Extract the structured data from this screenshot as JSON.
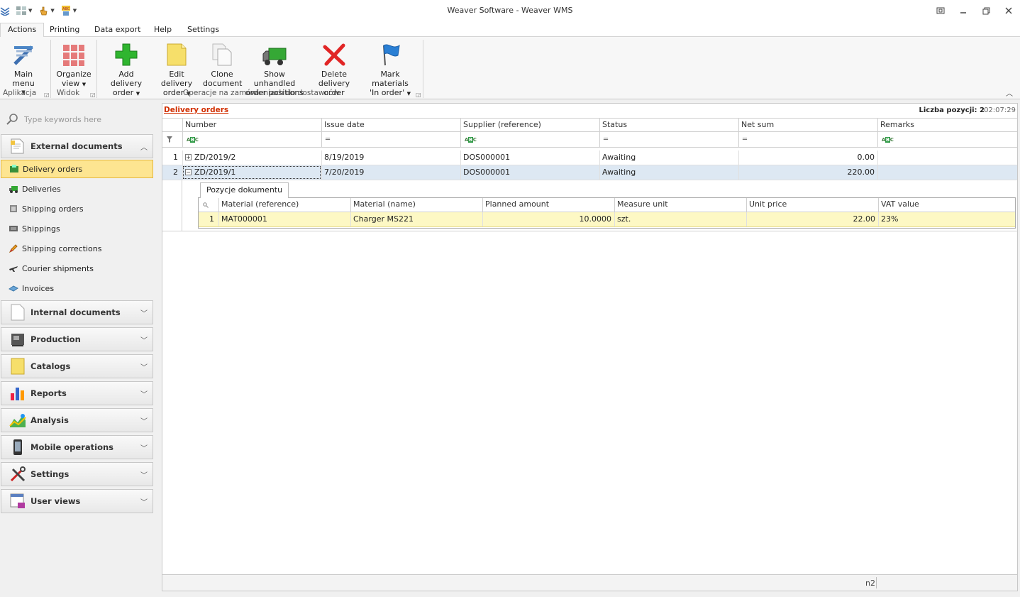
{
  "window": {
    "title": "Weaver Software - Weaver WMS"
  },
  "ribbon_tabs": [
    "Actions",
    "Printing",
    "Data export",
    "Help",
    "Settings"
  ],
  "ribbon": {
    "buttons": {
      "main_menu": {
        "line1": "Main menu",
        "line2": ""
      },
      "organize_view": {
        "line1": "Organize",
        "line2": "view"
      },
      "add_delivery": {
        "line1": "Add delivery",
        "line2": "order"
      },
      "edit_delivery": {
        "line1": "Edit delivery",
        "line2": "order"
      },
      "clone_document": {
        "line1": "Clone",
        "line2": "document"
      },
      "show_unhandled": {
        "line1": "Show unhandled",
        "line2": "order positions"
      },
      "delete_delivery": {
        "line1": "Delete",
        "line2": "delivery order"
      },
      "mark_materials": {
        "line1": "Mark materials",
        "line2": "'In order'"
      }
    },
    "groups": {
      "aplikacja": "Aplikacja",
      "widok": "Widok",
      "operacje": "Operacje na zamówieniach do dostawców"
    }
  },
  "sidebar": {
    "search_placeholder": "Type keywords here",
    "external_documents": "External documents",
    "items": [
      "Delivery orders",
      "Deliveries",
      "Shipping orders",
      "Shippings",
      "Shipping corrections",
      "Courier shipments",
      "Invoices"
    ],
    "groups": [
      "Internal documents",
      "Production",
      "Catalogs",
      "Reports",
      "Analysis",
      "Mobile operations",
      "Settings",
      "User views"
    ]
  },
  "main": {
    "title": "Delivery orders",
    "count_label": "Liczba pozycji: 2",
    "clock": "02:07:29",
    "columns": [
      "Number",
      "Issue date",
      "Supplier (reference)",
      "Status",
      "Net sum",
      "Remarks"
    ],
    "rows": [
      {
        "n": "1",
        "expander": "+",
        "number": "ZD/2019/2",
        "issue_date": "8/19/2019",
        "supplier": "DOS000001",
        "status": "Awaiting",
        "net_sum": "0.00",
        "remarks": ""
      },
      {
        "n": "2",
        "expander": "−",
        "number": "ZD/2019/1",
        "issue_date": "7/20/2019",
        "supplier": "DOS000001",
        "status": "Awaiting",
        "net_sum": "220.00",
        "remarks": ""
      }
    ],
    "detail": {
      "tab": "Pozycje dokumentu",
      "columns": [
        "Material (reference)",
        "Material (name)",
        "Planned amount",
        "Measure unit",
        "Unit price",
        "VAT value"
      ],
      "rows": [
        {
          "n": "1",
          "material_ref": "MAT000001",
          "material_name": "Charger MS221",
          "planned_amount": "10.0000",
          "measure_unit": "szt.",
          "unit_price": "22.00",
          "vat": "23%"
        }
      ]
    },
    "status_text": "n2"
  }
}
